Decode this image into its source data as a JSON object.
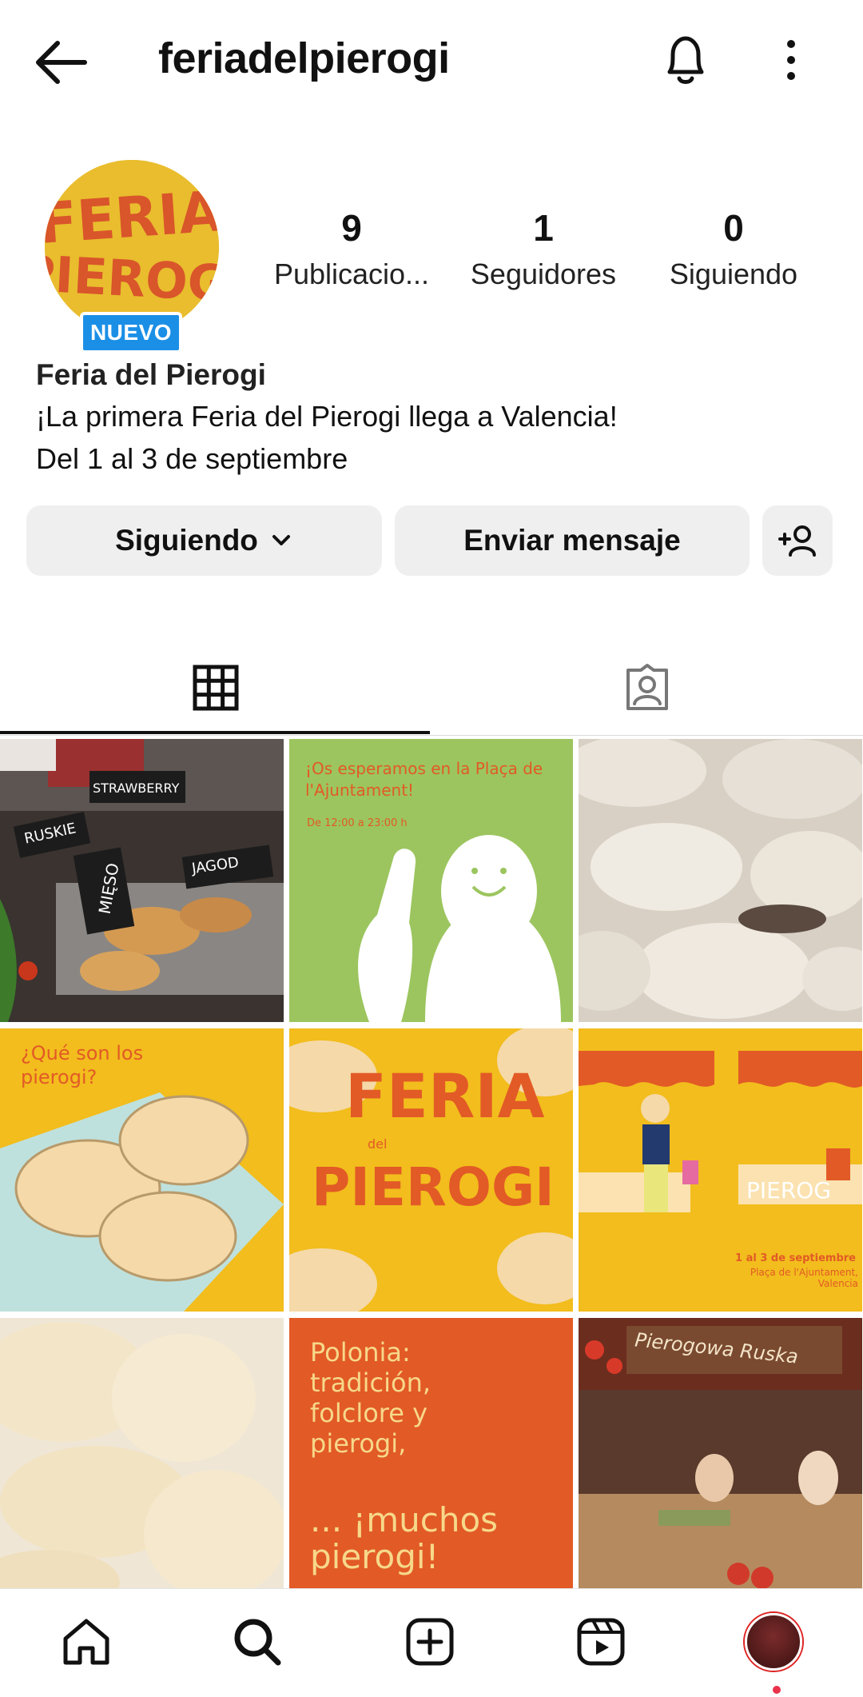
{
  "header": {
    "username": "feriadelpierogi"
  },
  "profile": {
    "badge": "NUEVO",
    "stats": [
      {
        "num": "9",
        "label": "Publicacio..."
      },
      {
        "num": "1",
        "label": "Seguidores"
      },
      {
        "num": "0",
        "label": "Siguiendo"
      }
    ],
    "name": "Feria del Pierogi",
    "bio": [
      "¡La primera Feria del Pierogi llega a Valencia!",
      "Del 1 al 3 de septiembre"
    ]
  },
  "actions": {
    "following": "Siguiendo",
    "message": "Enviar mensaje"
  },
  "posts": {
    "p1_labels": [
      "STRAWBERRY",
      "RUSKIE",
      "MIĘSO",
      "JAGOD"
    ],
    "p2_title": "¡Os esperamos en la Plaça de l'Ajuntament!",
    "p2_hours": "De 12:00 a 23:00 h",
    "p4_title": "¿Qué son los pierogi?",
    "p5_logo": [
      "FERIA",
      "del",
      "PIEROGI"
    ],
    "p6_sign": "PIEROG",
    "p6_date": "1 al 3 de septiembre",
    "p6_place": "Plaça de l'Ajuntament, Valencia",
    "p8_text": "Polonia: tradición, folclore y pierogi,",
    "p8_text2": "... ¡muchos pierogi!",
    "p9_sign": "Pierogowa Ruska"
  },
  "colors": {
    "brand_orange": "#e25a26",
    "brand_yellow": "#f2bd1d",
    "green": "#9cc55f",
    "badge_blue": "#1b8fe6"
  },
  "icons": [
    "arrow-left-icon",
    "bell-icon",
    "more-vertical-icon",
    "chevron-down-icon",
    "add-person-icon",
    "grid-icon",
    "tagged-icon",
    "home-icon",
    "search-icon",
    "add-post-icon",
    "reels-icon"
  ]
}
